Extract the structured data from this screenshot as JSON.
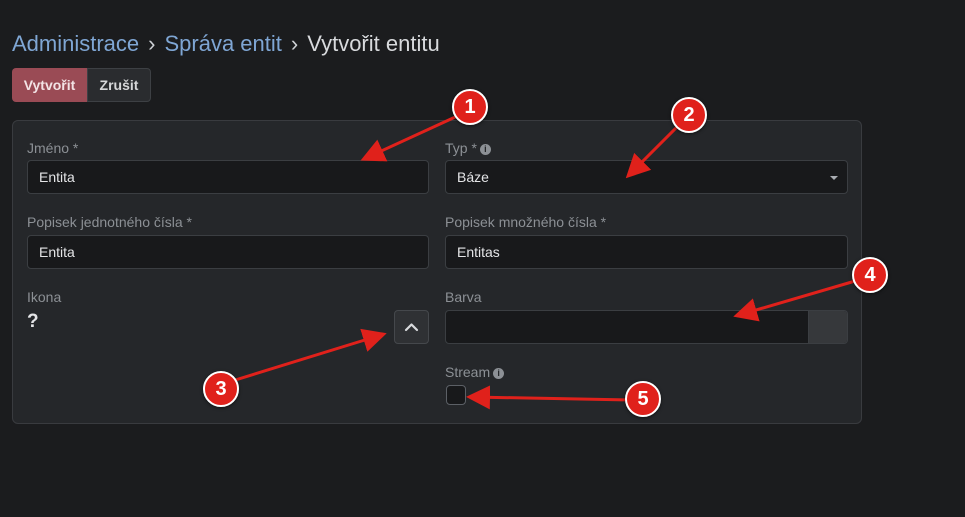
{
  "breadcrumb": {
    "items": [
      "Administrace",
      "Správa entit"
    ],
    "current": "Vytvořit entitu",
    "separator": "›"
  },
  "actions": {
    "create_label": "Vytvořit",
    "cancel_label": "Zrušit"
  },
  "form": {
    "name": {
      "label": "Jméno *",
      "value": "Entita"
    },
    "type": {
      "label": "Typ *",
      "value": "Báze"
    },
    "singular": {
      "label": "Popisek jednotného čísla *",
      "value": "Entita"
    },
    "plural": {
      "label": "Popisek množného čísla *",
      "value": "Entitas"
    },
    "icon": {
      "label": "Ikona",
      "value": "?"
    },
    "color": {
      "label": "Barva",
      "value": ""
    },
    "stream": {
      "label": "Stream",
      "checked": false
    }
  },
  "annotations": [
    "1",
    "2",
    "3",
    "4",
    "5"
  ],
  "colors": {
    "accent": "#9a4b55",
    "marker": "#e0211b",
    "link": "#7fa6d4"
  },
  "icons": [
    "info-icon",
    "chevron-up-icon",
    "caret-down-icon"
  ]
}
